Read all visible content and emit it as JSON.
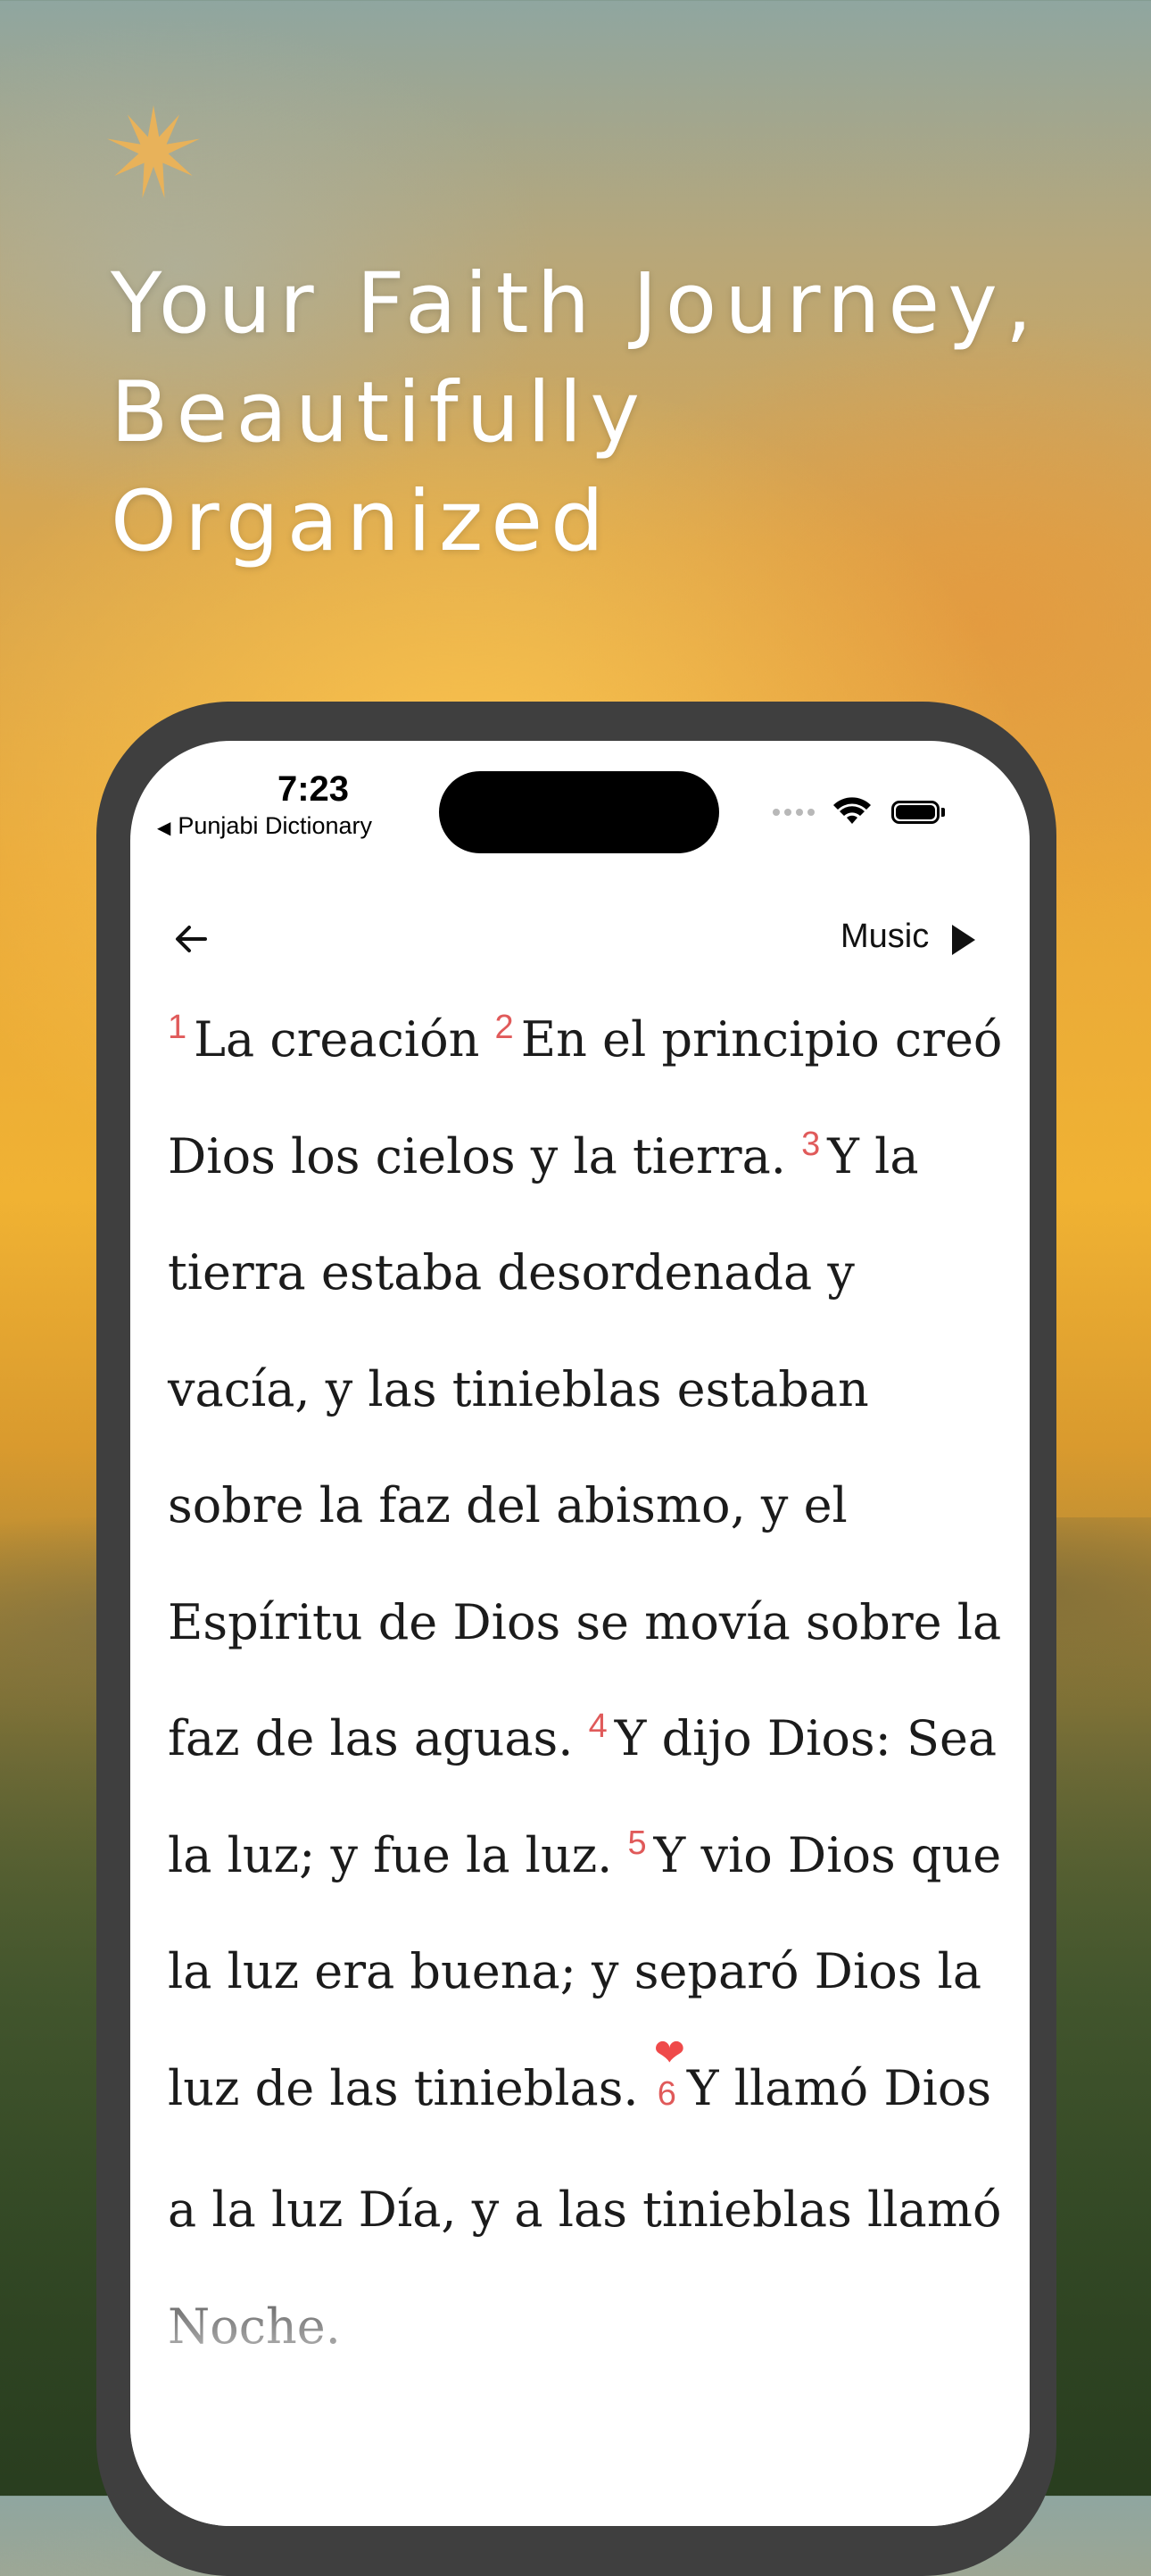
{
  "promo": {
    "headline_lines": [
      "Your Faith Journey,",
      "Beautifully",
      "Organized"
    ]
  },
  "status_bar": {
    "time": "7:23",
    "back_app": "Punjabi Dictionary"
  },
  "toolbar": {
    "music_label": "Music"
  },
  "verses": [
    {
      "num": "1",
      "text": "La creación"
    },
    {
      "num": "2",
      "text": "En el principio creó Dios los cielos y la tierra."
    },
    {
      "num": "3",
      "text": "Y la tierra estaba desordenada y vacía, y las tinieblas estaban sobre la faz del abismo, y el Espíritu de Dios se movía sobre la faz de las aguas."
    },
    {
      "num": "4",
      "text": "Y dijo Dios: Sea la luz; y fue la luz."
    },
    {
      "num": "5",
      "text": "Y vio Dios que la luz era buena; y separó Dios la luz de las tinieblas."
    },
    {
      "num": "6",
      "text": "Y llamó Dios a la luz Día, y a las tinieblas llamó Noche.",
      "favorited": true
    }
  ],
  "colors": {
    "verse_number": "#e05a5a",
    "heart": "#ef4a4a",
    "phone_frame": "#3f3f3f"
  },
  "icons": [
    "sun-star-icon",
    "back-arrow-icon",
    "play-icon",
    "wifi-icon",
    "battery-icon",
    "heart-icon"
  ]
}
